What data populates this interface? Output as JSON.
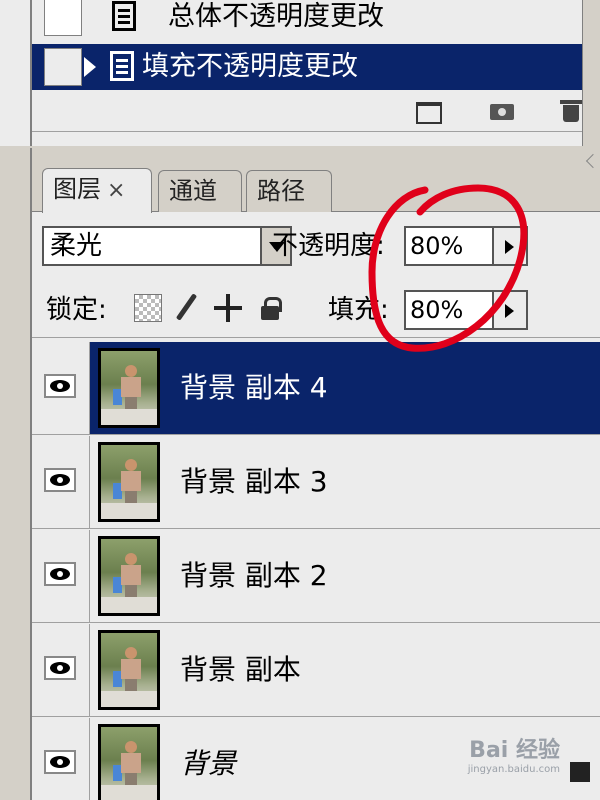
{
  "history": {
    "items": [
      {
        "label": "总体不透明度更改",
        "selected": false
      },
      {
        "label": "填充不透明度更改",
        "selected": true
      }
    ],
    "footer_icons": [
      "new-document-from-state-icon",
      "snapshot-camera-icon",
      "trash-icon"
    ]
  },
  "layers_panel": {
    "tabs": [
      {
        "label": "图层",
        "closable": true,
        "active": true
      },
      {
        "label": "通道",
        "active": false
      },
      {
        "label": "路径",
        "active": false
      }
    ],
    "blend_mode": "柔光",
    "opacity_label": "不透明度:",
    "opacity_value": "80%",
    "lock_label": "锁定:",
    "lock_icons": [
      "lock-transparency-icon",
      "lock-paint-brush-icon",
      "lock-move-icon",
      "lock-all-icon"
    ],
    "fill_label": "填充:",
    "fill_value": "80%",
    "layers": [
      {
        "name": "背景 副本 4",
        "visible": true,
        "selected": true
      },
      {
        "name": "背景 副本 3",
        "visible": true,
        "selected": false
      },
      {
        "name": "背景 副本 2",
        "visible": true,
        "selected": false
      },
      {
        "name": "背景 副本",
        "visible": true,
        "selected": false
      },
      {
        "name": "背景",
        "visible": true,
        "selected": false,
        "italic": true
      }
    ]
  },
  "annotation": {
    "color": "#e0001a"
  },
  "watermark": {
    "text": "Bai 经验",
    "subtext": "jingyan.baidu.com"
  },
  "colors": {
    "selection": "#0a246a",
    "panel": "#ececec",
    "frame": "#d4d0c8"
  }
}
